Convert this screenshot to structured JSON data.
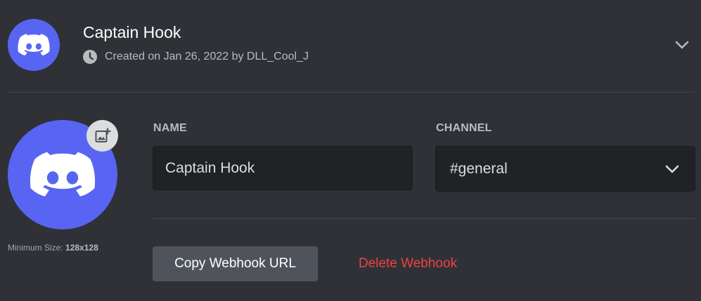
{
  "webhook": {
    "name": "Captain Hook",
    "meta": "Created on Jan 26, 2022 by DLL_Cool_J"
  },
  "avatar": {
    "min_size_label": "Minimum Size:",
    "min_size_value": "128x128",
    "icon": "discord-logo-icon",
    "upload_icon": "add-image-icon",
    "color": "#5865f2"
  },
  "form": {
    "name_label": "NAME",
    "name_value": "Captain Hook",
    "channel_label": "CHANNEL",
    "channel_value": "#general"
  },
  "actions": {
    "copy_label": "Copy Webhook URL",
    "delete_label": "Delete Webhook",
    "delete_color": "#ed4245"
  },
  "icons": {
    "meta": "clock-icon",
    "expand": "chevron-down-icon",
    "select": "chevron-down-icon"
  }
}
